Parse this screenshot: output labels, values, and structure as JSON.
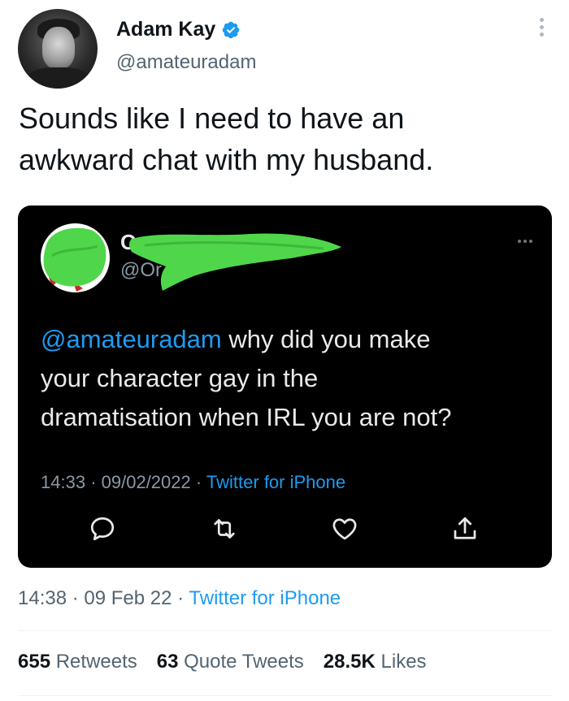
{
  "tweet": {
    "author": {
      "name": "Adam Kay",
      "handle": "@amateuradam",
      "verified": true,
      "avatar_icon": "avatar-photo"
    },
    "text_line1": "Sounds like I need to have an",
    "text_line2": "awkward chat with my husband.",
    "time": "14:38",
    "date": "09 Feb 22",
    "source": "Twitter for iPhone",
    "separator": "·"
  },
  "quoted_tweet": {
    "author_name_visible": "O",
    "author_handle_visible": "@Or",
    "avatar_icon": "redacted-avatar",
    "mention": "@amateuradam",
    "text_rest_line1": " why did you make",
    "text_line2": "your character gay in the",
    "text_line3": "dramatisation when IRL you are not?",
    "time": "14:33",
    "date": "09/02/2022",
    "source": "Twitter for iPhone",
    "actions": [
      "reply-icon",
      "retweet-icon",
      "like-icon",
      "share-icon"
    ]
  },
  "stats": {
    "retweets_count": "655",
    "retweets_label": "Retweets",
    "quotes_count": "63",
    "quotes_label": "Quote Tweets",
    "likes_count": "28.5K",
    "likes_label": "Likes"
  },
  "colors": {
    "accent": "#1d9bf0",
    "redaction": "#4fd64a",
    "card_bg": "#000000"
  }
}
